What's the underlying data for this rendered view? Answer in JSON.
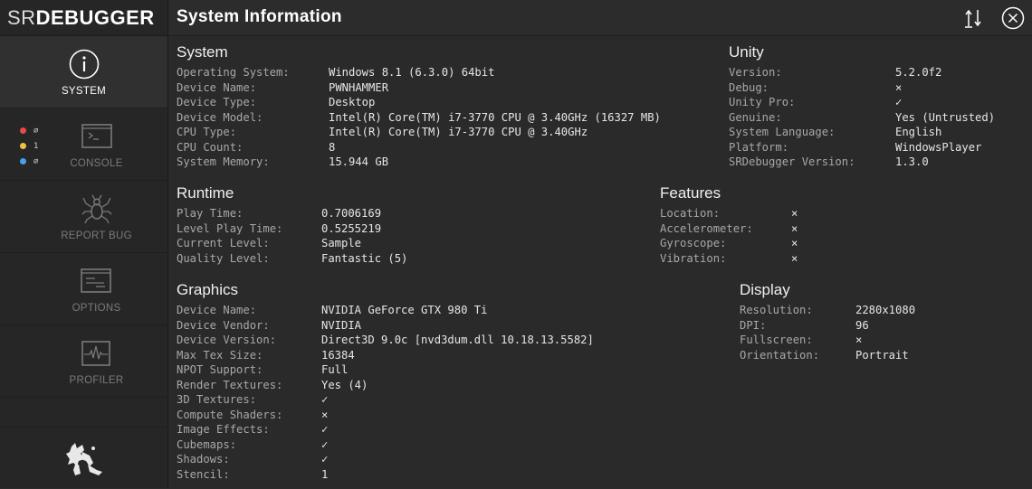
{
  "logo": {
    "part1": "SR",
    "part2": "DEBUGGER"
  },
  "header": {
    "title": "System Information"
  },
  "sidebar": {
    "tabs": [
      {
        "label": "SYSTEM",
        "icon": "info-icon"
      },
      {
        "label": "CONSOLE",
        "icon": "console-icon"
      },
      {
        "label": "REPORT BUG",
        "icon": "bug-icon"
      },
      {
        "label": "OPTIONS",
        "icon": "options-icon"
      },
      {
        "label": "PROFILER",
        "icon": "profiler-icon"
      }
    ],
    "console_counts": [
      {
        "color": "#e84a4a",
        "value": "⌀"
      },
      {
        "color": "#f0c040",
        "value": "1"
      },
      {
        "color": "#4aa0e8",
        "value": "⌀"
      }
    ]
  },
  "sections": {
    "system": {
      "title": "System",
      "rows": [
        {
          "k": "Operating System:",
          "v": "Windows 8.1  (6.3.0) 64bit"
        },
        {
          "k": "Device Name:",
          "v": "PWNHAMMER"
        },
        {
          "k": "Device Type:",
          "v": "Desktop"
        },
        {
          "k": "Device Model:",
          "v": "Intel(R) Core(TM) i7-3770 CPU @ 3.40GHz (16327 MB)"
        },
        {
          "k": "CPU Type:",
          "v": "Intel(R) Core(TM) i7-3770 CPU @ 3.40GHz"
        },
        {
          "k": "CPU Count:",
          "v": "8"
        },
        {
          "k": "System Memory:",
          "v": "15.944 GB"
        }
      ]
    },
    "unity": {
      "title": "Unity",
      "rows": [
        {
          "k": "Version:",
          "v": "5.2.0f2"
        },
        {
          "k": "Debug:",
          "v": "×"
        },
        {
          "k": "Unity Pro:",
          "v": "✓"
        },
        {
          "k": "Genuine:",
          "v": "Yes (Untrusted)"
        },
        {
          "k": "System Language:",
          "v": "English"
        },
        {
          "k": "Platform:",
          "v": "WindowsPlayer"
        },
        {
          "k": "SRDebugger Version:",
          "v": "1.3.0"
        }
      ]
    },
    "runtime": {
      "title": "Runtime",
      "rows": [
        {
          "k": "Play Time:",
          "v": "0.7006169"
        },
        {
          "k": "Level Play Time:",
          "v": "0.5255219"
        },
        {
          "k": "Current Level:",
          "v": "Sample"
        },
        {
          "k": "Quality Level:",
          "v": "Fantastic (5)"
        }
      ]
    },
    "features": {
      "title": "Features",
      "rows": [
        {
          "k": "Location:",
          "v": "×"
        },
        {
          "k": "Accelerometer:",
          "v": "×"
        },
        {
          "k": "Gyroscope:",
          "v": "×"
        },
        {
          "k": "Vibration:",
          "v": "×"
        }
      ]
    },
    "graphics": {
      "title": "Graphics",
      "rows": [
        {
          "k": "Device Name:",
          "v": "NVIDIA GeForce GTX 980 Ti"
        },
        {
          "k": "Device Vendor:",
          "v": "NVIDIA"
        },
        {
          "k": "Device Version:",
          "v": "Direct3D 9.0c [nvd3dum.dll 10.18.13.5582]"
        },
        {
          "k": "Max Tex Size:",
          "v": "16384"
        },
        {
          "k": "NPOT Support:",
          "v": "Full"
        },
        {
          "k": "Render Textures:",
          "v": "Yes (4)"
        },
        {
          "k": "3D Textures:",
          "v": "✓"
        },
        {
          "k": "Compute Shaders:",
          "v": "×"
        },
        {
          "k": "Image Effects:",
          "v": "✓"
        },
        {
          "k": "Cubemaps:",
          "v": "✓"
        },
        {
          "k": "Shadows:",
          "v": "✓"
        },
        {
          "k": "Stencil:",
          "v": "1"
        }
      ]
    },
    "display": {
      "title": "Display",
      "rows": [
        {
          "k": "Resolution:",
          "v": "2280x1080"
        },
        {
          "k": "DPI:",
          "v": "96"
        },
        {
          "k": "Fullscreen:",
          "v": "×"
        },
        {
          "k": "Orientation:",
          "v": "Portrait"
        }
      ]
    }
  }
}
